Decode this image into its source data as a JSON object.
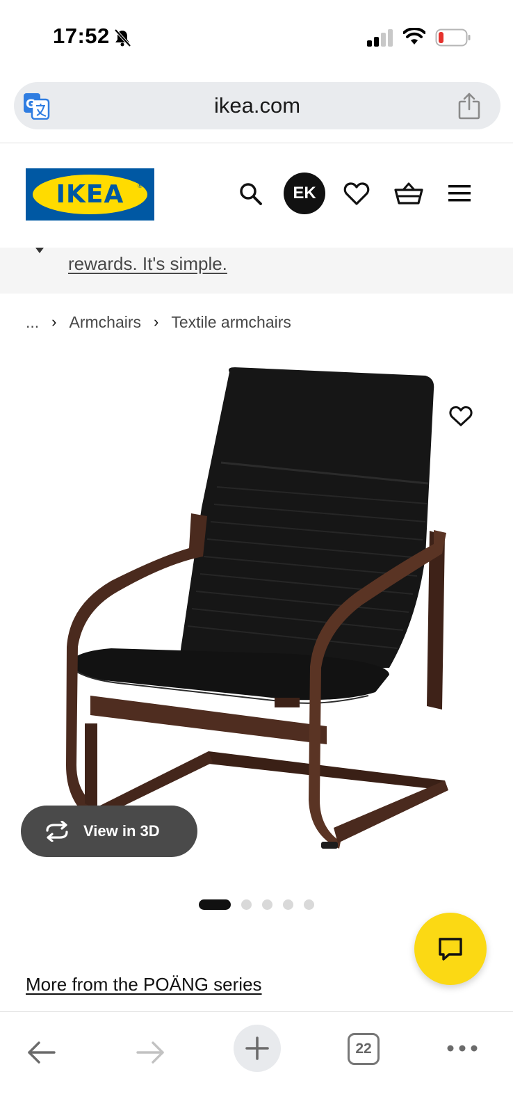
{
  "status_bar": {
    "time": "17:52",
    "icons": [
      "bell-slash-icon",
      "cellular-signal-icon",
      "wifi-icon",
      "battery-low-icon"
    ]
  },
  "browser": {
    "url": "ikea.com",
    "icons": [
      "translate-icon",
      "share-icon"
    ]
  },
  "header": {
    "logo_text": "IKEA",
    "avatar_initials": "EK",
    "icons": [
      "search-icon",
      "heart-icon",
      "basket-icon",
      "menu-icon"
    ]
  },
  "promo": {
    "link_text": "rewards. It's simple."
  },
  "breadcrumb": {
    "items": [
      "...",
      "Armchairs",
      "Textile armchairs"
    ]
  },
  "product": {
    "view_3d_label": "View in 3D",
    "gallery": {
      "total_images": 5,
      "active_index": 0
    }
  },
  "series_link": "More from the POÄNG series",
  "toolbar": {
    "tab_count": "22",
    "icons": [
      "back-arrow-icon",
      "forward-arrow-icon",
      "new-tab-plus-icon",
      "tabs-icon",
      "more-icon"
    ]
  },
  "colors": {
    "ikea_blue": "#0058a3",
    "ikea_yellow": "#ffdb00",
    "chat_yellow": "#fbd914",
    "chair_frame": "#4a2a1e",
    "chair_cushion": "#141414"
  }
}
